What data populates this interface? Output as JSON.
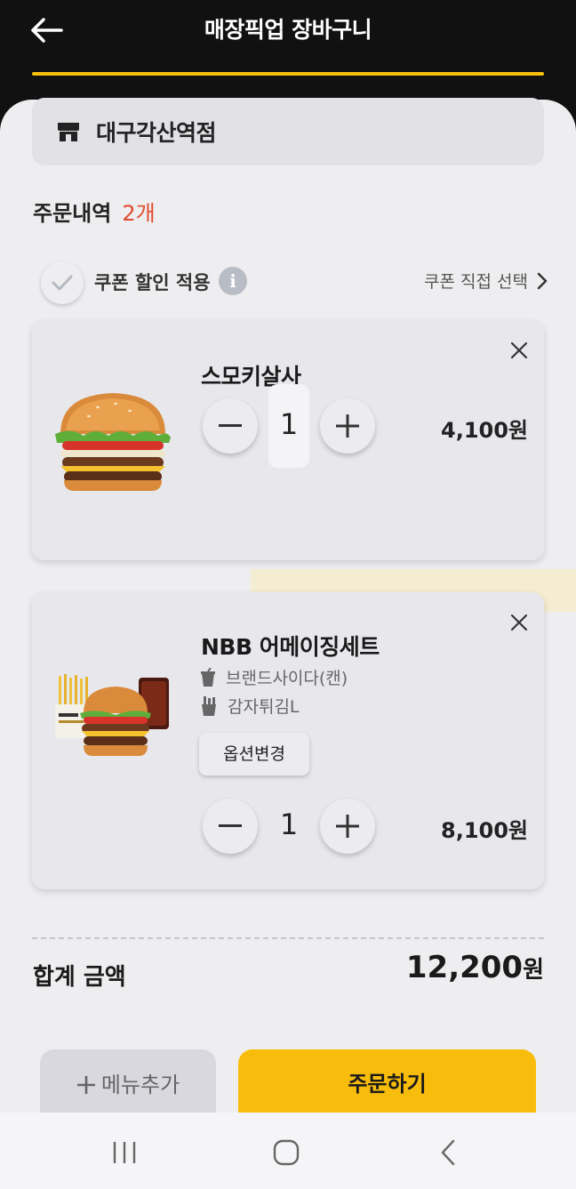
{
  "header": {
    "title": "매장픽업 장바구니"
  },
  "store": {
    "name": "대구각산역점"
  },
  "order": {
    "title": "주문내역",
    "count": "2개"
  },
  "coupon": {
    "label": "쿠폰 할인 적용",
    "info": "i",
    "select_label": "쿠폰 직접 선택"
  },
  "items": [
    {
      "name": "스모키살사",
      "quantity": "1",
      "price": "4,100원"
    },
    {
      "name": "NBB 어메이징세트",
      "options": [
        "브랜드사이다(캔)",
        "감자튀김L"
      ],
      "option_button": "옵션변경",
      "quantity": "1",
      "price": "8,100원"
    }
  ],
  "total": {
    "label": "합계 금액",
    "amount": "12,200",
    "unit": "원"
  },
  "actions": {
    "add_menu": "메뉴추가",
    "order": "주문하기"
  },
  "colors": {
    "accent": "#f8bd0c",
    "count_red": "#e04a2f",
    "header_bg": "#111111",
    "sheet_bg": "#eeeef0"
  }
}
